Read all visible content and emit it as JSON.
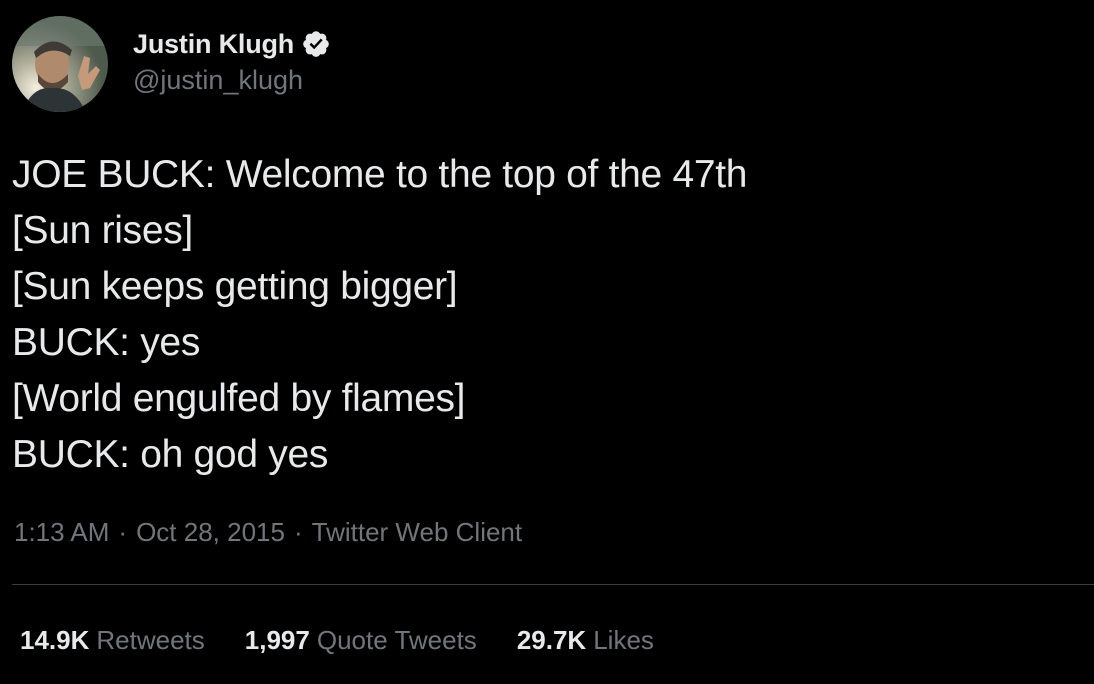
{
  "user": {
    "display_name": "Justin Klugh",
    "handle": "@justin_klugh",
    "verified_icon": "verified-badge-icon",
    "avatar_icon": "profile-photo"
  },
  "tweet": {
    "lines": [
      "JOE BUCK: Welcome to the top of the 47th",
      "[Sun rises]",
      "[Sun keeps getting bigger]",
      "BUCK: yes",
      "[World engulfed by flames]",
      "BUCK: oh god yes"
    ]
  },
  "meta": {
    "time": "1:13 AM",
    "separator": "·",
    "date": "Oct 28, 2015",
    "source": "Twitter Web Client"
  },
  "stats": {
    "retweets_count": "14.9K",
    "retweets_label": "Retweets",
    "quotes_count": "1,997",
    "quotes_label": "Quote Tweets",
    "likes_count": "29.7K",
    "likes_label": "Likes"
  },
  "colors": {
    "background": "#000000",
    "primary_text": "#e7e9ea",
    "secondary_text": "#71767b",
    "divider": "#3a3d40"
  }
}
